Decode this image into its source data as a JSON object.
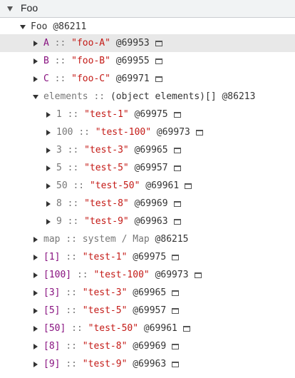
{
  "header": {
    "title": "Foo"
  },
  "root": {
    "name": "Foo",
    "id": "@86211"
  },
  "props": [
    {
      "key": "A",
      "value": "\"foo-A\"",
      "id": "@69953"
    },
    {
      "key": "B",
      "value": "\"foo-B\"",
      "id": "@69955"
    },
    {
      "key": "C",
      "value": "\"foo-C\"",
      "id": "@69971"
    }
  ],
  "elements": {
    "key": "elements",
    "type": "(object elements)[]",
    "id": "@86213",
    "items": [
      {
        "key": "1",
        "value": "\"test-1\"",
        "id": "@69975"
      },
      {
        "key": "100",
        "value": "\"test-100\"",
        "id": "@69973"
      },
      {
        "key": "3",
        "value": "\"test-3\"",
        "id": "@69965"
      },
      {
        "key": "5",
        "value": "\"test-5\"",
        "id": "@69957"
      },
      {
        "key": "50",
        "value": "\"test-50\"",
        "id": "@69961"
      },
      {
        "key": "8",
        "value": "\"test-8\"",
        "id": "@69969"
      },
      {
        "key": "9",
        "value": "\"test-9\"",
        "id": "@69963"
      }
    ]
  },
  "map": {
    "key": "map",
    "type": "system / Map",
    "id": "@86215"
  },
  "mapEntries": [
    {
      "key": "[1]",
      "value": "\"test-1\"",
      "id": "@69975"
    },
    {
      "key": "[100]",
      "value": "\"test-100\"",
      "id": "@69973"
    },
    {
      "key": "[3]",
      "value": "\"test-3\"",
      "id": "@69965"
    },
    {
      "key": "[5]",
      "value": "\"test-5\"",
      "id": "@69957"
    },
    {
      "key": "[50]",
      "value": "\"test-50\"",
      "id": "@69961"
    },
    {
      "key": "[8]",
      "value": "\"test-8\"",
      "id": "@69969"
    },
    {
      "key": "[9]",
      "value": "\"test-9\"",
      "id": "@69963"
    }
  ],
  "separator": "::"
}
